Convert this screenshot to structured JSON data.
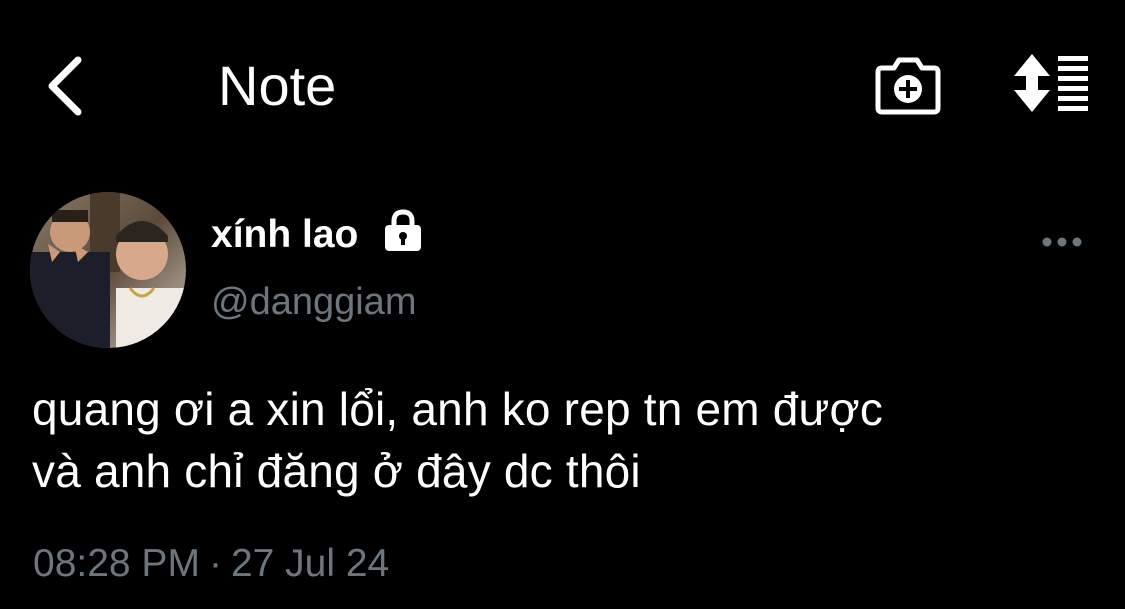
{
  "header": {
    "title": "Note",
    "back_icon": "chevron-left-icon",
    "camera_icon": "camera-plus-icon",
    "sort_icon": "sort-lines-icon"
  },
  "post": {
    "author": {
      "display_name": "xính lao",
      "handle": "@danggiam",
      "verified_icon": "lock-icon"
    },
    "more_icon": "ellipsis-icon",
    "text_lines": [
      "quang ơi a xin lổi, anh ko rep tn em được",
      "và anh chỉ đăng ở đây dc thôi"
    ],
    "time": "08:28 PM",
    "separator": "·",
    "date": "27 Jul 24"
  },
  "colors": {
    "background": "#000000",
    "text_primary": "#ffffff",
    "text_secondary": "#6e767d"
  }
}
